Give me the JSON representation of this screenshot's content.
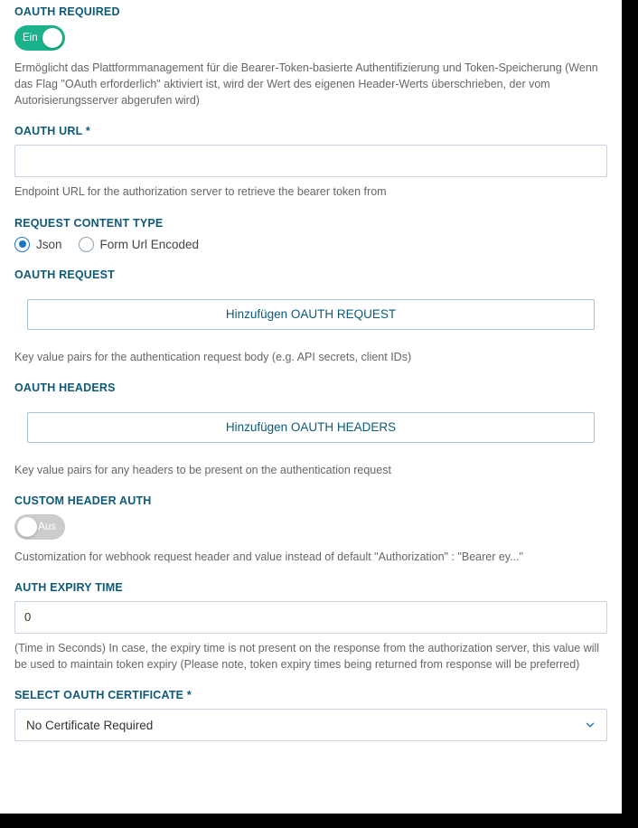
{
  "oauth_required": {
    "label": "OAUTH REQUIRED",
    "toggle_on_text": "Ein",
    "help": "Ermöglicht das Plattformmanagement für die Bearer-Token-basierte Authentifizierung und Token-Speicherung (Wenn das Flag \"OAuth erforderlich\" aktiviert ist, wird der Wert des eigenen Header-Werts überschrieben, der vom Autorisierungsserver abgerufen wird)"
  },
  "oauth_url": {
    "label": "OAUTH URL *",
    "value": "",
    "help": "Endpoint URL for the authorization server to retrieve the bearer token from"
  },
  "request_content_type": {
    "label": "REQUEST CONTENT TYPE",
    "options": {
      "json": "Json",
      "form": "Form Url Encoded"
    },
    "selected": "json"
  },
  "oauth_request": {
    "label": "OAUTH REQUEST",
    "add_button": "Hinzufügen OAUTH REQUEST",
    "help": "Key value pairs for the authentication request body (e.g. API secrets, client IDs)"
  },
  "oauth_headers": {
    "label": "OAUTH HEADERS",
    "add_button": "Hinzufügen OAUTH HEADERS",
    "help": "Key value pairs for any headers to be present on the authentication request"
  },
  "custom_header_auth": {
    "label": "CUSTOM HEADER AUTH",
    "toggle_off_text": "Aus",
    "help": "Customization for webhook request header and value instead of default \"Authorization\" : \"Bearer ey...\""
  },
  "auth_expiry_time": {
    "label": "AUTH EXPIRY TIME",
    "value": "0",
    "help": "(Time in Seconds) In case, the expiry time is not present on the response from the authorization server, this value will be used to maintain token expiry (Please note, token expiry times being returned from response will be preferred)"
  },
  "oauth_certificate": {
    "label": "SELECT OAUTH CERTIFICATE *",
    "selected": "No Certificate Required"
  }
}
